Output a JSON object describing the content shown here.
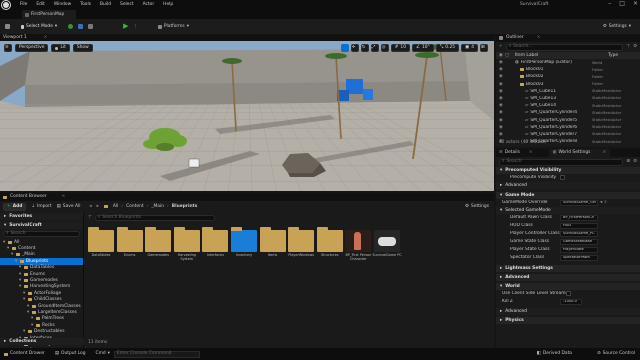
{
  "app": {
    "menu": [
      "File",
      "Edit",
      "Window",
      "Tools",
      "Build",
      "Select",
      "Actor",
      "Help"
    ],
    "map_tab": "FirstPersonMap",
    "project_name": "SurvivalCraft"
  },
  "toolbar": {
    "select_mode": "Select Mode",
    "platforms": "Platforms",
    "settings": "Settings"
  },
  "viewport": {
    "tab": "Viewport 1",
    "perspective": "Perspective",
    "lit": "Lit",
    "show": "Show",
    "snap_grid": "10",
    "snap_angle": "10°",
    "snap_scale": "0.25",
    "cam_speed": "4"
  },
  "outliner": {
    "tab": "Outliner",
    "search_placeholder": "Search...",
    "col_label": "Item Label",
    "col_type": "Type",
    "rows": [
      {
        "label": "FirstPersonMap (Editor)",
        "type": "World",
        "depth": 0,
        "kind": "world"
      },
      {
        "label": "Block01",
        "type": "Folder",
        "depth": 1,
        "kind": "folder"
      },
      {
        "label": "Block02",
        "type": "Folder",
        "depth": 1,
        "kind": "folder"
      },
      {
        "label": "Block03",
        "type": "Folder",
        "depth": 1,
        "kind": "folder"
      },
      {
        "label": "SM_Cube11",
        "type": "StaticMeshActor",
        "depth": 2,
        "kind": "mesh"
      },
      {
        "label": "SM_Cube13",
        "type": "StaticMeshActor",
        "depth": 2,
        "kind": "mesh"
      },
      {
        "label": "SM_Cube14",
        "type": "StaticMeshActor",
        "depth": 2,
        "kind": "mesh"
      },
      {
        "label": "SM_QuarterCylinder4",
        "type": "StaticMeshActor",
        "depth": 2,
        "kind": "mesh"
      },
      {
        "label": "SM_QuarterCylinder5",
        "type": "StaticMeshActor",
        "depth": 2,
        "kind": "mesh"
      },
      {
        "label": "SM_QuarterCylinder6",
        "type": "StaticMeshActor",
        "depth": 2,
        "kind": "mesh"
      },
      {
        "label": "SM_QuarterCylinder7",
        "type": "StaticMeshActor",
        "depth": 2,
        "kind": "mesh"
      },
      {
        "label": "SM_QuarterCylinder8",
        "type": "StaticMeshActor",
        "depth": 2,
        "kind": "mesh"
      }
    ],
    "status": "42 actors (42 loaded)"
  },
  "details": {
    "tab_details": "Details",
    "tab_world": "World Settings",
    "search_placeholder": "Search",
    "sections": {
      "precomputed": "Precomputed Visibility",
      "advanced1": "Advanced",
      "game_mode": "Game Mode",
      "selected_gm": "Selected GameMode",
      "lightmass": "Lightmass Settings",
      "advanced2": "Advanced",
      "world": "World",
      "advanced3": "Advanced",
      "physics": "Physics"
    },
    "props": {
      "precomp_vis": "Precompute Visibility",
      "gm_override_label": "GameMode Override",
      "gm_override_value": "SurvivalGame_GM",
      "pawn_label": "Default Pawn Class",
      "pawn_value": "BP_FirstPersonCh",
      "hud_label": "HUD Class",
      "hud_value": "HUD",
      "pc_label": "Player Controller Class",
      "pc_value": "SurvivalGame_PC",
      "gs_label": "Game State Class",
      "gs_value": "GameStateBase",
      "ps_label": "Player State Class",
      "ps_value": "PlayerState",
      "spec_label": "Spectator Class",
      "spec_value": "SpectatorPawn",
      "wc_label": "Use Client Side Level Streaming V",
      "kill_label": "Kill Z",
      "kill_value": "-1000.0"
    }
  },
  "content_browser": {
    "tab": "Content Browser",
    "add": "Add",
    "import": "Import",
    "save_all": "Save All",
    "breadcrumb": [
      "All",
      "Content",
      "_Main",
      "Blueprints"
    ],
    "settings": "Settings",
    "favorites": "Favorites",
    "project": "SurvivalCraft",
    "search_tree_placeholder": "Search",
    "search_assets_placeholder": "Search Blueprints",
    "tree": [
      {
        "label": "All",
        "depth": 0
      },
      {
        "label": "Content",
        "depth": 1
      },
      {
        "label": "_Main",
        "depth": 2
      },
      {
        "label": "Blueprints",
        "depth": 3,
        "selected": true
      },
      {
        "label": "DataTables",
        "depth": 4
      },
      {
        "label": "Enums",
        "depth": 4
      },
      {
        "label": "Gamemodes",
        "depth": 4
      },
      {
        "label": "HarvestingSystem",
        "depth": 4
      },
      {
        "label": "ActorFoliage",
        "depth": 5
      },
      {
        "label": "ChildClasses",
        "depth": 5
      },
      {
        "label": "GroundItemClasses",
        "depth": 6
      },
      {
        "label": "LargeItemClasses",
        "depth": 6
      },
      {
        "label": "PalmTrees",
        "depth": 7
      },
      {
        "label": "Rocks",
        "depth": 7
      },
      {
        "label": "Destructables",
        "depth": 5
      },
      {
        "label": "Interfaces",
        "depth": 4
      },
      {
        "label": "Inventory",
        "depth": 4
      },
      {
        "label": "Items",
        "depth": 4
      }
    ],
    "assets": [
      {
        "label": "DataTables",
        "kind": "folder"
      },
      {
        "label": "Enums",
        "kind": "folder"
      },
      {
        "label": "Gamemodes",
        "kind": "folder"
      },
      {
        "label": "Harvesting System",
        "kind": "folder"
      },
      {
        "label": "Interfaces",
        "kind": "folder"
      },
      {
        "label": "Inventory",
        "kind": "folder-blue"
      },
      {
        "label": "Items",
        "kind": "folder"
      },
      {
        "label": "PlayerWindows",
        "kind": "folder"
      },
      {
        "label": "Structures",
        "kind": "folder"
      },
      {
        "label": "BP_First Person Character",
        "kind": "character"
      },
      {
        "label": "SurvivalGame PC",
        "kind": "gamepad"
      }
    ],
    "item_count": "11 items",
    "collections": "Collections"
  },
  "statusbar": {
    "content_drawer": "Content Drawer",
    "output_log": "Output Log",
    "cmd": "Cmd",
    "console_placeholder": "Enter Console Command",
    "derived": "Derived Data",
    "source_control": "Source Control"
  },
  "colors": {
    "accent_blue": "#0a70d0",
    "folder": "#c8a355",
    "folder_blue": "#1a7dd8",
    "panel": "#1a1a1a",
    "sky": "#8aa9c8"
  }
}
